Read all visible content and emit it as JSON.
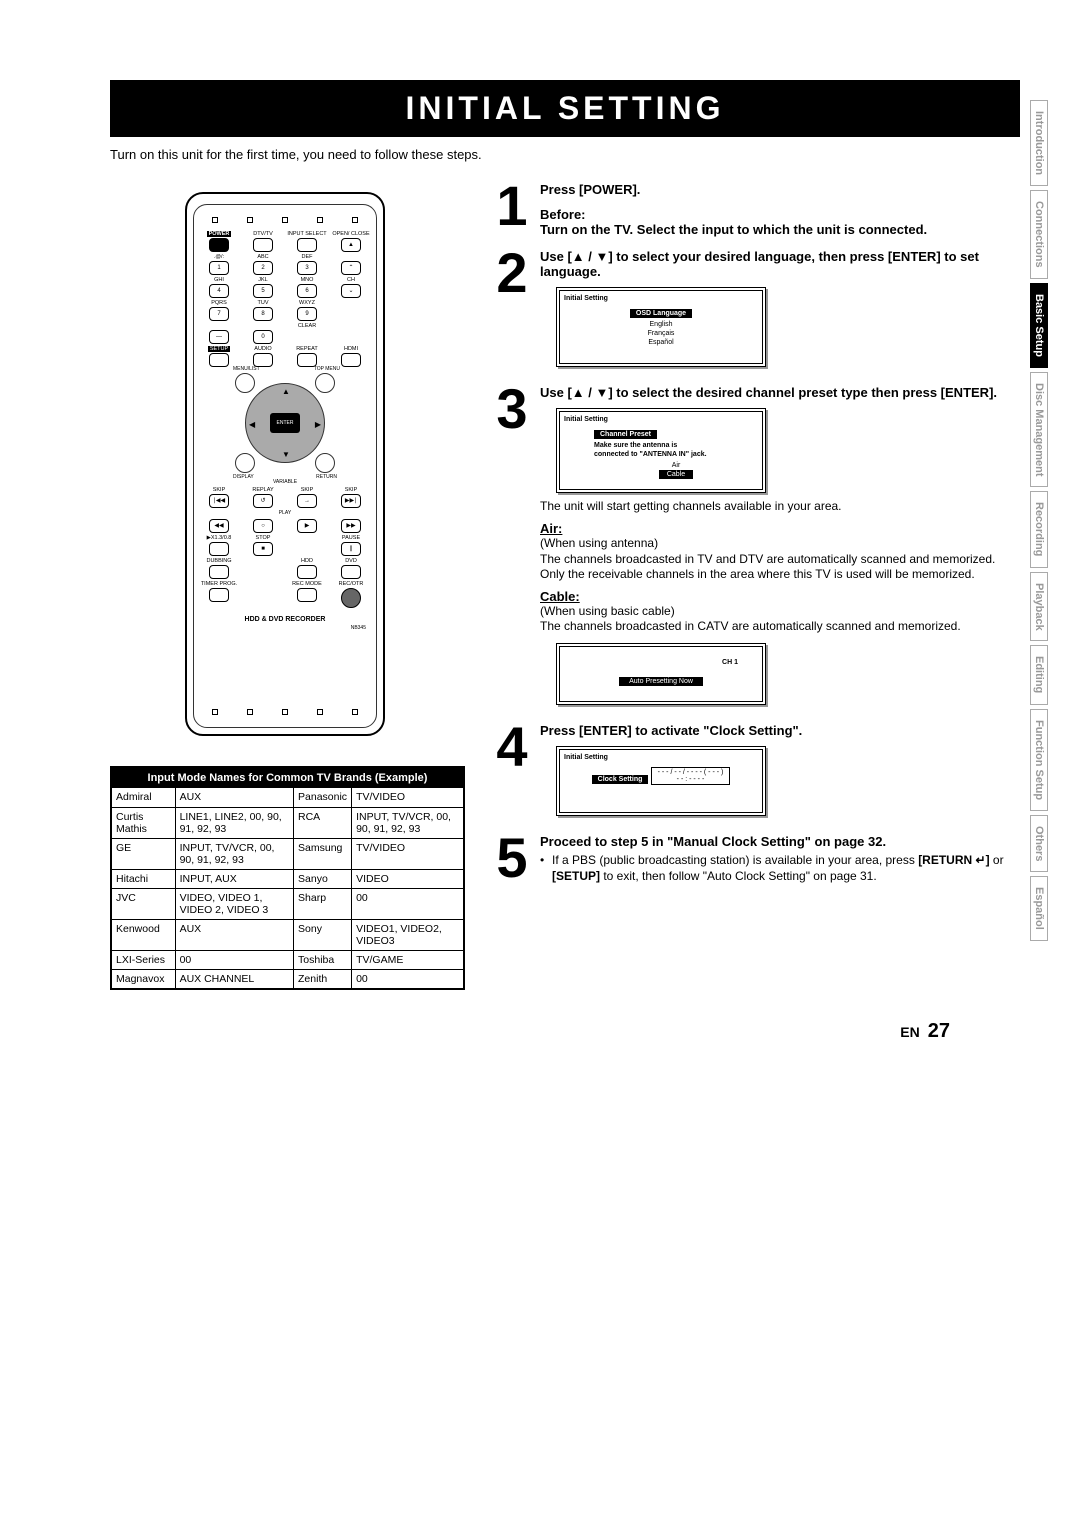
{
  "title_bar": "INITIAL SETTING",
  "intro": "Turn on this unit for the first time, you need to follow these steps.",
  "remote": {
    "row1": [
      {
        "lbl": "POWER",
        "black": true
      },
      {
        "lbl": "DTV/TV"
      },
      {
        "lbl": "INPUT SELECT"
      },
      {
        "lbl": "OPEN/ CLOSE",
        "sym": "▲"
      }
    ],
    "numpad": [
      {
        "lbl": ".@/:",
        "n": "1"
      },
      {
        "lbl": "ABC",
        "n": "2"
      },
      {
        "lbl": "DEF",
        "n": "3"
      },
      {
        "lbl": "",
        "n": "⌃",
        "side": "ch"
      },
      {
        "lbl": "GHI",
        "n": "4"
      },
      {
        "lbl": "JKL",
        "n": "5"
      },
      {
        "lbl": "MNO",
        "n": "6"
      },
      {
        "lbl": "CH",
        "n": "⌄",
        "side": "ch"
      },
      {
        "lbl": "PQRS",
        "n": "7"
      },
      {
        "lbl": "TUV",
        "n": "8"
      },
      {
        "lbl": "WXYZ",
        "n": "9"
      },
      {
        "lbl": "",
        "n": "",
        "side": "blank"
      }
    ],
    "row_clear": [
      {
        "n": "—"
      },
      {
        "n": "0"
      },
      {
        "lbl": "CLEAR",
        "blank_btn": true
      }
    ],
    "row_setup": [
      "SETUP",
      "AUDIO",
      "REPEAT",
      "HDMI"
    ],
    "nav": {
      "tl": "MENU/LIST",
      "tr": "TOP MENU",
      "bl": "DISPLAY",
      "br": "RETURN",
      "enter": "ENTER"
    },
    "row_skip": [
      "SKIP",
      "REPLAY",
      "SKIP",
      "SKIP"
    ],
    "row_skip_sym": [
      "∣◀◀",
      "↺",
      "→",
      "▶▶∣"
    ],
    "variable": "VARIABLE",
    "play_lbl": "PLAY",
    "row_play": [
      "◀◀",
      "○",
      "▶",
      "▶▶"
    ],
    "row_stop": [
      "▶X1.3/0.8",
      "STOP",
      "",
      "PAUSE"
    ],
    "row_stop_sym": [
      "",
      "■",
      "",
      "∥"
    ],
    "row_dub": [
      "DUBBING",
      "",
      "HDD",
      "DVD"
    ],
    "row_timer": [
      "TIMER PROG.",
      "",
      "REC MODE",
      "REC/OTR"
    ],
    "title": "HDD & DVD RECORDER",
    "sub": "NB345"
  },
  "input_table": {
    "header": "Input Mode Names for Common TV Brands (Example)",
    "rows": [
      [
        "Admiral",
        "AUX",
        "Panasonic",
        "TV/VIDEO"
      ],
      [
        "Curtis Mathis",
        "LINE1, LINE2, 00, 90, 91, 92, 93",
        "RCA",
        "INPUT, TV/VCR, 00, 90, 91, 92, 93"
      ],
      [
        "GE",
        "INPUT, TV/VCR, 00, 90, 91, 92, 93",
        "Samsung",
        "TV/VIDEO"
      ],
      [
        "Hitachi",
        "INPUT, AUX",
        "Sanyo",
        "VIDEO"
      ],
      [
        "JVC",
        "VIDEO, VIDEO 1, VIDEO 2, VIDEO 3",
        "Sharp",
        "00"
      ],
      [
        "Kenwood",
        "AUX",
        "Sony",
        "VIDEO1, VIDEO2, VIDEO3"
      ],
      [
        "LXI-Series",
        "00",
        "Toshiba",
        "TV/GAME"
      ],
      [
        "Magnavox",
        "AUX CHANNEL",
        "Zenith",
        "00"
      ]
    ]
  },
  "steps": {
    "s1": {
      "num": "1",
      "l1": "Press [POWER].",
      "l2": "Before:",
      "l3": "Turn on the TV. Select the input to which the unit is connected."
    },
    "s2": {
      "num": "2",
      "l1": "Use [▲ / ▼] to select your desired language, then press [ENTER] to set language.",
      "osd_title": "Initial Setting",
      "osd_banner": "OSD Language",
      "osd_items": [
        "English",
        "Français",
        "Español"
      ]
    },
    "s3": {
      "num": "3",
      "l1": "Use [▲ / ▼] to select the desired channel preset type then press [ENTER].",
      "osd_title": "Initial Setting",
      "osd_banner": "Channel Preset",
      "osd_msg1": "Make sure the antenna is",
      "osd_msg2": "connected to \"ANTENNA IN\" jack.",
      "osd_items": [
        "Air",
        "Cable"
      ],
      "after": "The unit will start getting channels available in your area.",
      "air_h": "Air:",
      "air_1": "(When using antenna)",
      "air_2": "The channels broadcasted in TV and DTV are automatically scanned and memorized. Only the receivable channels in the area where this TV is used will be memorized.",
      "cable_h": "Cable:",
      "cable_1": "(When using basic cable)",
      "cable_2": "The channels broadcasted in CATV are automatically scanned and memorized.",
      "osd2_ch": "CH   1",
      "osd2_msg": "Auto Presetting Now"
    },
    "s4": {
      "num": "4",
      "l1": "Press [ENTER] to activate \"Clock Setting\".",
      "osd_title": "Initial Setting",
      "osd_banner": "Clock Setting",
      "osd_line": "- - - / - - / - - - - ( - - - )",
      "osd_line2": "- - : - - - -"
    },
    "s5": {
      "num": "5",
      "l1": "Proceed to step 5 in \"Manual Clock Setting\" on page 32.",
      "b1a": "If a PBS (public broadcasting station) is available in your area, press ",
      "b1b": "[RETURN ↵]",
      "b1c": " or ",
      "b1d": "[SETUP]",
      "b1e": " to exit, then follow \"Auto Clock Setting\" on page 31."
    }
  },
  "tabs": [
    "Introduction",
    "Connections",
    "Basic Setup",
    "Disc Management",
    "Recording",
    "Playback",
    "Editing",
    "Function Setup",
    "Others",
    "Español"
  ],
  "active_tab": "Basic Setup",
  "footer": {
    "en": "EN",
    "page": "27"
  }
}
